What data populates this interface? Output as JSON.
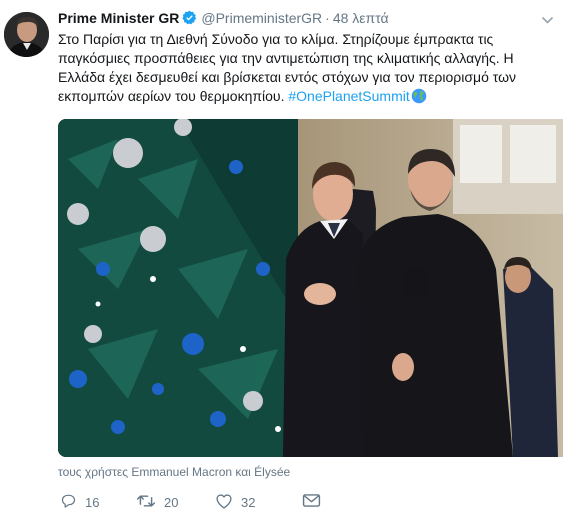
{
  "tweet": {
    "author_name": "Prime Minister GR",
    "handle": "@PrimeministerGR",
    "separator": "·",
    "time": "48 λεπτά",
    "text_main": "Στο Παρίσι για τη Διεθνή Σύνοδο για το κλίμα. Στηρίζουμε έμπρακτα τις παγκόσμιες προσπάθειες για την αντιμετώπιση της κλιματικής αλλαγής. Η Ελλάδα έχει δεσμευθεί και βρίσκεται εντός στόχων για τον περιορισμό των εκπομπών αερίων του θερμοκηπίου. ",
    "hashtag": "#OnePlanetSummit",
    "tagged_users": "τους χρήστες Emmanuel Macron και Élysée",
    "replies": "16",
    "retweets": "20",
    "likes": "32"
  },
  "icons": {
    "verified": "verified-badge-icon",
    "caret": "chevron-down-icon",
    "globe": "globe-emoji-icon",
    "reply": "reply-icon",
    "retweet": "retweet-icon",
    "like": "heart-icon",
    "dm": "envelope-icon"
  },
  "colors": {
    "accent": "#1da1f2",
    "secondary_text": "#657786",
    "primary_text": "#14171a"
  }
}
